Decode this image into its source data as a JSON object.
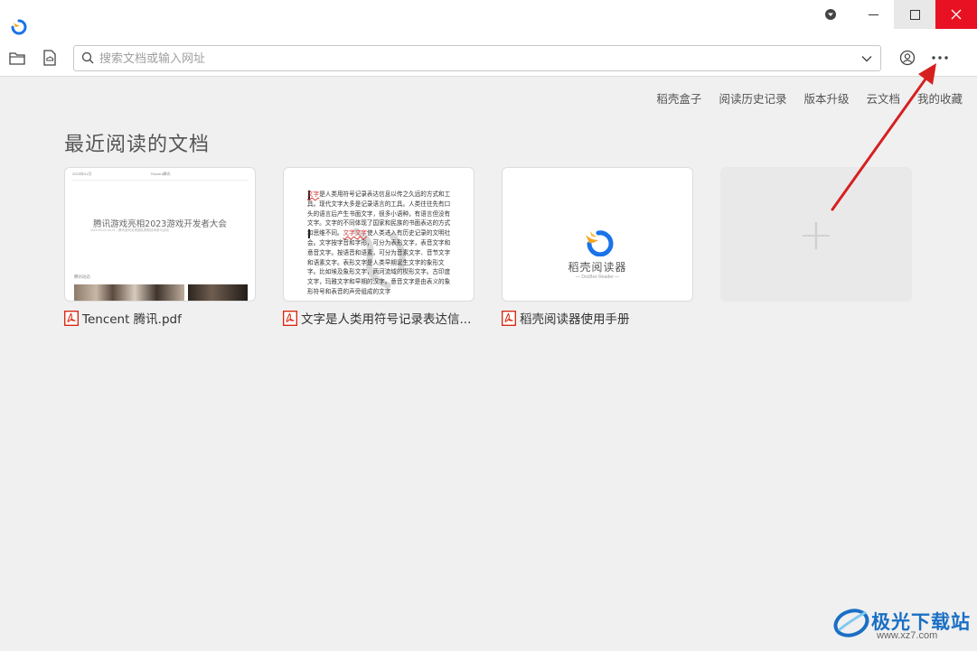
{
  "search": {
    "placeholder": "搜索文档或输入网址",
    "value": ""
  },
  "nav_links": [
    "稻壳盒子",
    "阅读历史记录",
    "版本升级",
    "云文档",
    "我的收藏"
  ],
  "section_title": "最近阅读的文档",
  "recent_docs": [
    {
      "label": "Tencent 腾讯.pdf",
      "preview": {
        "header_left": "2023年01月",
        "header_right": "Tencent腾讯",
        "title": "腾讯游戏亮相2023游戏开发者大会",
        "subtitle": "2023.03.21-03.24，腾讯游戏全球团队携新技术参与活动",
        "section": "腾讯动态"
      }
    },
    {
      "label": "文字是人类用符号记录表达信...",
      "preview": {
        "highlight1": "文字",
        "paragraph1": "是人类用符号记录表达信息以传之久远的方式和工具。现代文字大多是记录语言的工具。人类往往先有口头的语言后产生书面文字，很多小语种，有语言但没有文字。文字的不同体现了国家和民族的书面表达的方式和思维不同。",
        "highlight2": "文字文字",
        "paragraph2": "使人类进入有历史记录的文明社会。文字按字音和字形，可分为表形文字，表音文字和意音文字。按语音和语素，可分为音素文字、音节文字和语素文字。表形文字是人类早期诞生文字的象形文字。比如埃及象形文字，两河流域的楔形文字。古印度文字，玛雅文字和早期的汉字。意音文字是由表义的象形符号和表音的声旁组成的文字"
      }
    },
    {
      "label": "稻壳阅读器使用手册",
      "preview": {
        "name": "稻壳阅读器",
        "subtitle": "— DocBox Reader —"
      }
    }
  ],
  "add_card": {
    "symbol": "+"
  },
  "watermark": {
    "text": "极光下载站",
    "url": "www.xz7.com"
  },
  "colors": {
    "arrow": "#d62020",
    "close_button": "#e81123",
    "pdf_icon": "#d81e06",
    "brand_blue": "#1a6fc4"
  }
}
